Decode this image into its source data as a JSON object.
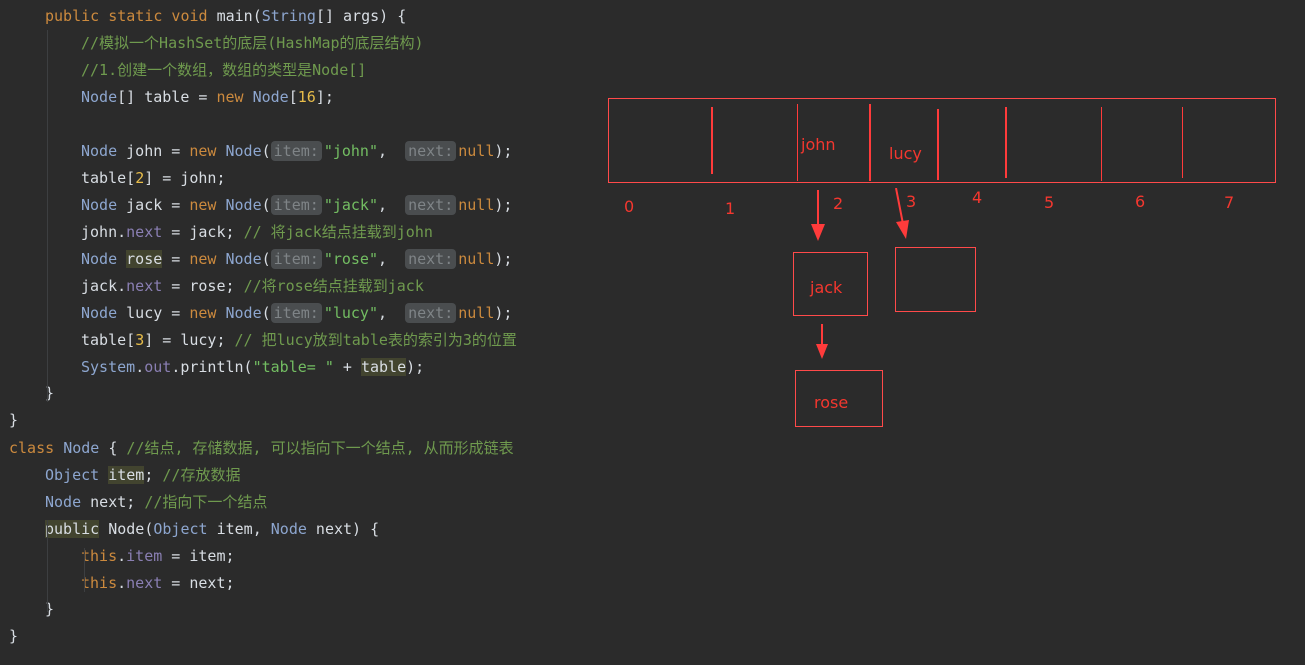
{
  "code": {
    "lines": [
      {
        "indent": 45,
        "tokens": [
          [
            "kw",
            "public static void "
          ],
          [
            "mh",
            "main"
          ],
          [
            "",
            "("
          ],
          [
            "ty",
            "String"
          ],
          [
            "",
            "[] args) {"
          ]
        ]
      },
      {
        "indent": 81,
        "tokens": [
          [
            "cm",
            "//模拟一个HashSet的底层(HashMap的底层结构)"
          ]
        ]
      },
      {
        "indent": 81,
        "tokens": [
          [
            "cm",
            "//1.创建一个数组，数组的类型是Node[]"
          ]
        ]
      },
      {
        "indent": 81,
        "tokens": [
          [
            "ty",
            "Node"
          ],
          [
            "",
            "[] table = "
          ],
          [
            "kw",
            "new "
          ],
          [
            "ty",
            "Node"
          ],
          [
            "",
            "["
          ],
          [
            "num",
            "16"
          ],
          [
            "",
            "];"
          ]
        ]
      },
      {
        "indent": 81,
        "tokens": []
      },
      {
        "indent": 81,
        "tokens": [
          [
            "ty",
            "Node"
          ],
          [
            "",
            " john = "
          ],
          [
            "kw",
            "new "
          ],
          [
            "ty",
            "Node"
          ],
          [
            "",
            "("
          ],
          [
            "hint",
            "item:"
          ],
          [
            "str",
            "\"john\""
          ],
          [
            "",
            ",  "
          ],
          [
            "hint",
            "next:"
          ],
          [
            "kw",
            "null"
          ],
          [
            "",
            ");"
          ]
        ]
      },
      {
        "indent": 81,
        "tokens": [
          [
            "",
            "table["
          ],
          [
            "num",
            "2"
          ],
          [
            "",
            "] = john;"
          ]
        ]
      },
      {
        "indent": 81,
        "tokens": [
          [
            "ty",
            "Node"
          ],
          [
            "",
            " jack = "
          ],
          [
            "kw",
            "new "
          ],
          [
            "ty",
            "Node"
          ],
          [
            "",
            "("
          ],
          [
            "hint",
            "item:"
          ],
          [
            "str",
            "\"jack\""
          ],
          [
            "",
            ",  "
          ],
          [
            "hint",
            "next:"
          ],
          [
            "kw",
            "null"
          ],
          [
            "",
            ");"
          ]
        ]
      },
      {
        "indent": 81,
        "tokens": [
          [
            "",
            "john."
          ],
          [
            "fld",
            "next"
          ],
          [
            "",
            " = jack; "
          ],
          [
            "cm",
            "// 将jack结点挂载到john"
          ]
        ]
      },
      {
        "indent": 81,
        "tokens": [
          [
            "ty",
            "Node"
          ],
          [
            "",
            " "
          ],
          [
            "hl",
            "rose"
          ],
          [
            "",
            " = "
          ],
          [
            "kw",
            "new "
          ],
          [
            "ty",
            "Node"
          ],
          [
            "",
            "("
          ],
          [
            "hint",
            "item:"
          ],
          [
            "str",
            "\"rose\""
          ],
          [
            "",
            ",  "
          ],
          [
            "hint",
            "next:"
          ],
          [
            "kw",
            "null"
          ],
          [
            "",
            ");"
          ]
        ]
      },
      {
        "indent": 81,
        "tokens": [
          [
            "",
            "jack."
          ],
          [
            "fld",
            "next"
          ],
          [
            "",
            " = rose; "
          ],
          [
            "cm",
            "//将rose结点挂载到jack"
          ]
        ]
      },
      {
        "indent": 81,
        "tokens": [
          [
            "ty",
            "Node"
          ],
          [
            "",
            " lucy = "
          ],
          [
            "kw",
            "new "
          ],
          [
            "ty",
            "Node"
          ],
          [
            "",
            "("
          ],
          [
            "hint",
            "item:"
          ],
          [
            "str",
            "\"lucy\""
          ],
          [
            "",
            ",  "
          ],
          [
            "hint",
            "next:"
          ],
          [
            "kw",
            "null"
          ],
          [
            "",
            ");"
          ]
        ]
      },
      {
        "indent": 81,
        "tokens": [
          [
            "",
            "table["
          ],
          [
            "num",
            "3"
          ],
          [
            "",
            "] = lucy; "
          ],
          [
            "cm",
            "// 把lucy放到table表的索引为3的位置"
          ]
        ]
      },
      {
        "indent": 81,
        "tokens": [
          [
            "ty",
            "System"
          ],
          [
            "",
            "."
          ],
          [
            "fld",
            "out"
          ],
          [
            "",
            ".println("
          ],
          [
            "str",
            "\"table= \""
          ],
          [
            "",
            " + "
          ],
          [
            "hl",
            "table"
          ],
          [
            "",
            ");"
          ]
        ]
      },
      {
        "indent": 45,
        "tokens": [
          [
            "",
            "}"
          ]
        ]
      },
      {
        "indent": 9,
        "tokens": [
          [
            "",
            "}"
          ]
        ]
      },
      {
        "indent": 9,
        "tokens": [
          [
            "kw",
            "class "
          ],
          [
            "ty",
            "Node"
          ],
          [
            "",
            " { "
          ],
          [
            "cm",
            "//结点, 存储数据, 可以指向下一个结点, 从而形成链表"
          ]
        ]
      },
      {
        "indent": 45,
        "tokens": [
          [
            "ty",
            "Object"
          ],
          [
            "",
            " "
          ],
          [
            "hl",
            "item"
          ],
          [
            "",
            "; "
          ],
          [
            "cm",
            "//存放数据"
          ]
        ]
      },
      {
        "indent": 45,
        "tokens": [
          [
            "ty",
            "Node"
          ],
          [
            "",
            " next; "
          ],
          [
            "cm",
            "//指向下一个结点"
          ]
        ]
      },
      {
        "indent": 45,
        "tokens": [
          [
            "hl",
            "public"
          ],
          [
            "",
            " Node("
          ],
          [
            "ty",
            "Object"
          ],
          [
            "",
            " item, "
          ],
          [
            "ty",
            "Node"
          ],
          [
            "",
            " next) {"
          ]
        ]
      },
      {
        "indent": 81,
        "tokens": [
          [
            "kw",
            "this"
          ],
          [
            "",
            "."
          ],
          [
            "fld",
            "item"
          ],
          [
            "",
            " = item;"
          ]
        ]
      },
      {
        "indent": 81,
        "tokens": [
          [
            "kw",
            "this"
          ],
          [
            "",
            "."
          ],
          [
            "fld",
            "next"
          ],
          [
            "",
            " = next;"
          ]
        ]
      },
      {
        "indent": 45,
        "tokens": [
          [
            "",
            "}"
          ]
        ]
      },
      {
        "indent": 9,
        "tokens": [
          [
            "",
            "}"
          ]
        ]
      }
    ]
  },
  "diagram": {
    "slot_labels": [
      "0",
      "1",
      "2",
      "3",
      "4",
      "5",
      "6",
      "7"
    ],
    "names": {
      "john": "john",
      "lucy": "lucy",
      "jack": "jack",
      "rose": "rose"
    }
  }
}
